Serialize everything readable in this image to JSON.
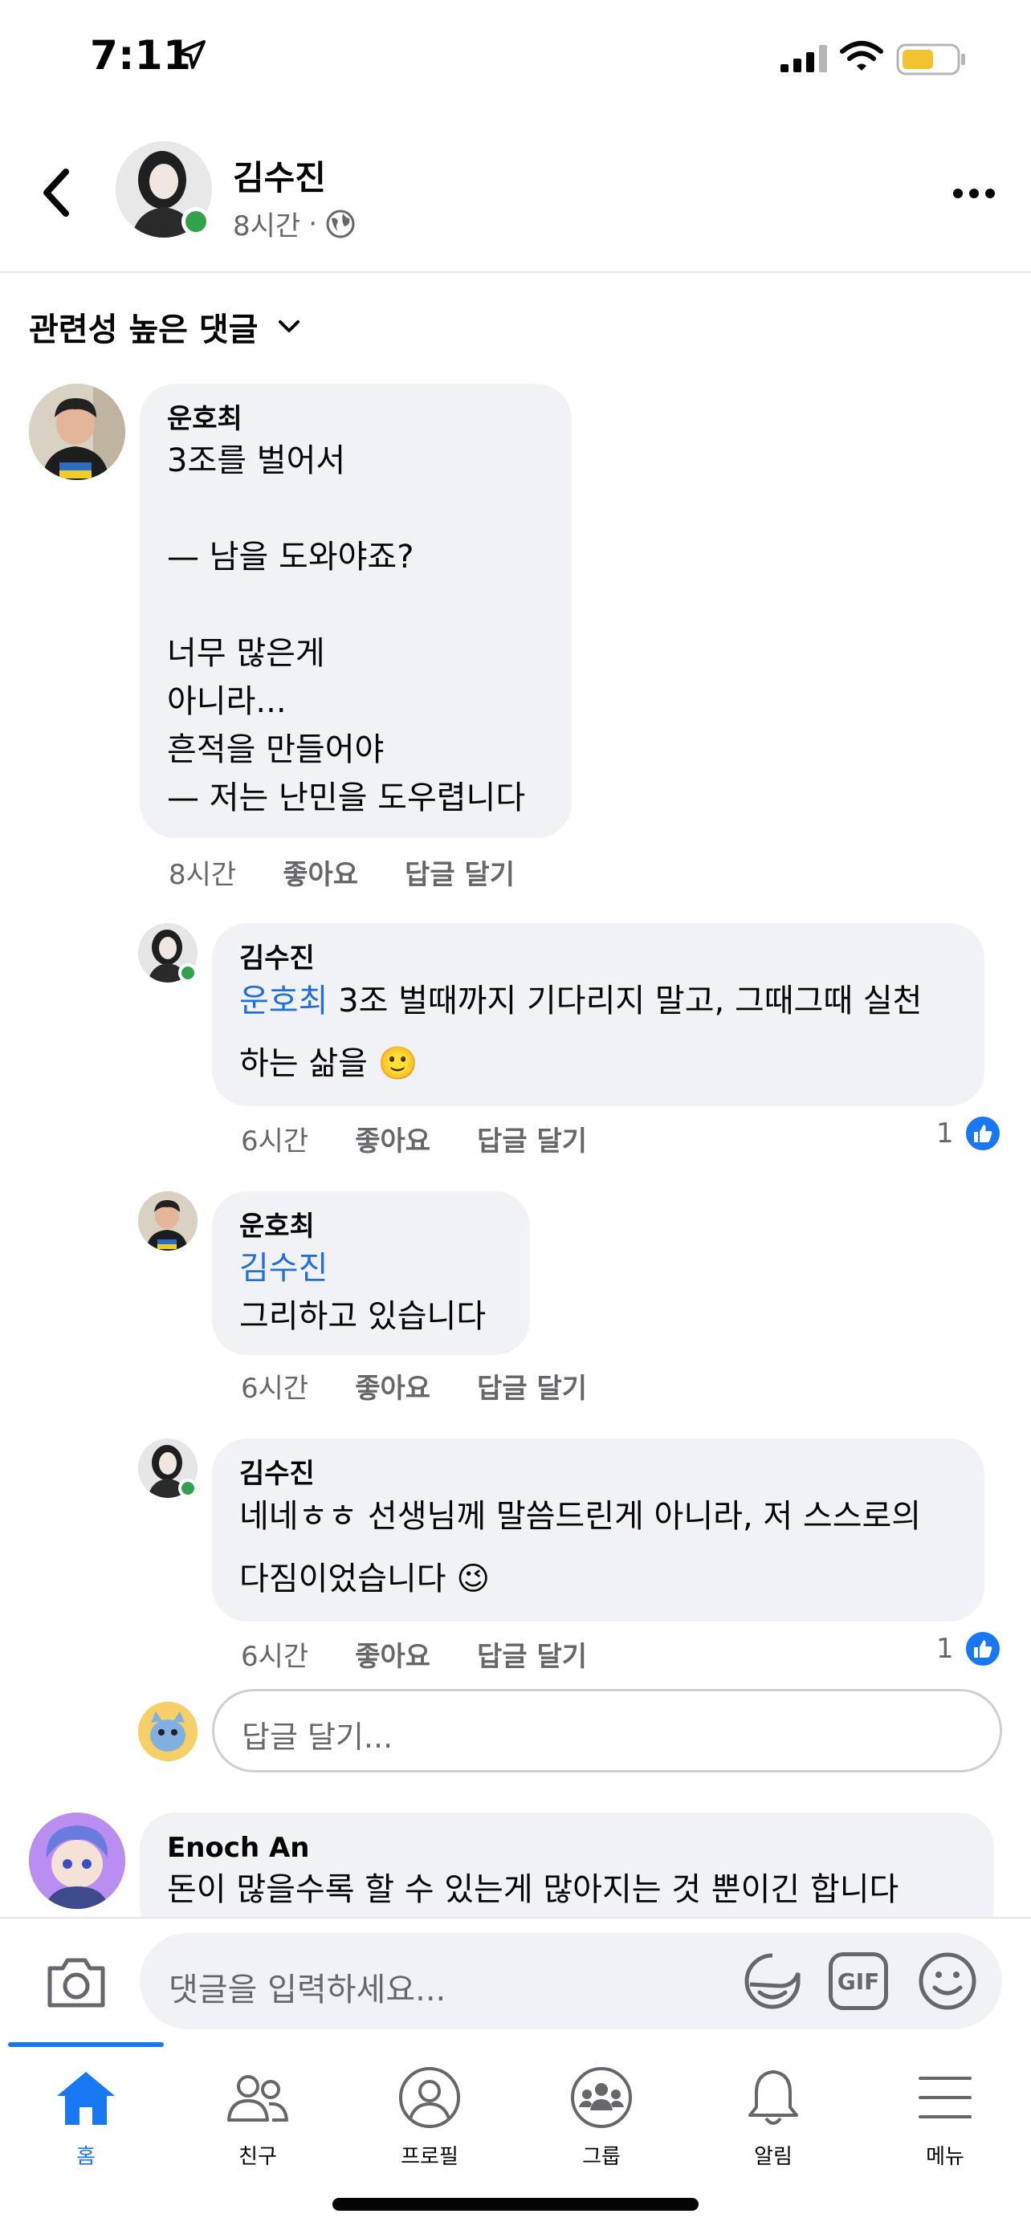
{
  "status_bar": {
    "time": "7:11"
  },
  "post_header": {
    "author": "김수진",
    "time": "8시간",
    "separator": "·"
  },
  "sort": {
    "label": "관련성 높은 댓글"
  },
  "comments": [
    {
      "author": "운호최",
      "text": "3조를 벌어서\n\n— 남을 도와야죠?\n\n너무 많은게\n아니라...\n흔적을 만들어야\n— 저는 난민을 도우렵니다",
      "time": "8시간",
      "like": "좋아요",
      "reply": "답글 달기"
    },
    {
      "author": "김수진",
      "mention": "운호최",
      "text": " 3조 벌때까지 기다리지 말고, 그때그때 실천\n하는 삶을 🙂",
      "time": "6시간",
      "like": "좋아요",
      "reply": "답글 달기",
      "like_count": "1"
    },
    {
      "author": "운호최",
      "mention": "김수진",
      "text": "그리하고 있습니다",
      "time": "6시간",
      "like": "좋아요",
      "reply": "답글 달기"
    },
    {
      "author": "김수진",
      "text": "네네ㅎㅎ 선생님께 말씀드린게 아니라, 저 스스로의\n다짐이었습니다 😉",
      "time": "6시간",
      "like": "좋아요",
      "reply": "답글 달기",
      "like_count": "1"
    },
    {
      "author": "Enoch An",
      "text": "돈이 많을수록 할 수 있는게 많아지는 것 뿐이긴 합니다"
    }
  ],
  "reply_input": {
    "placeholder": "답글 달기..."
  },
  "composer": {
    "placeholder": "댓글을 입력하세요...",
    "gif_label": "GIF"
  },
  "tabs": [
    {
      "label": "홈"
    },
    {
      "label": "친구"
    },
    {
      "label": "프로필"
    },
    {
      "label": "그룹"
    },
    {
      "label": "알림"
    },
    {
      "label": "메뉴"
    }
  ],
  "colors": {
    "accent": "#1877f2",
    "mention": "#216fdb",
    "online": "#31a24c",
    "bubble": "#f0f2f5"
  }
}
